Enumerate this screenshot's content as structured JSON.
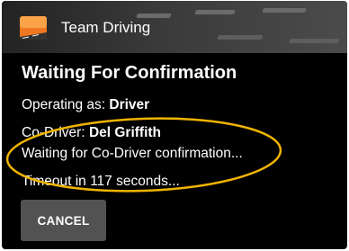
{
  "app_bar": {
    "title": "Team Driving",
    "icon": "road-icon"
  },
  "dialog": {
    "title": "Waiting For Confirmation",
    "operating_as_label": "Operating as:",
    "operating_as_value": "Driver",
    "co_driver_label": "Co-Driver:",
    "co_driver_value": "Del Griffith",
    "waiting_message": "Waiting for Co-Driver confirmation...",
    "timeout_message": "Timeout in 117 seconds...",
    "cancel_label": "CANCEL"
  },
  "annotation": {
    "shape": "ellipse",
    "color": "#f0b400"
  }
}
